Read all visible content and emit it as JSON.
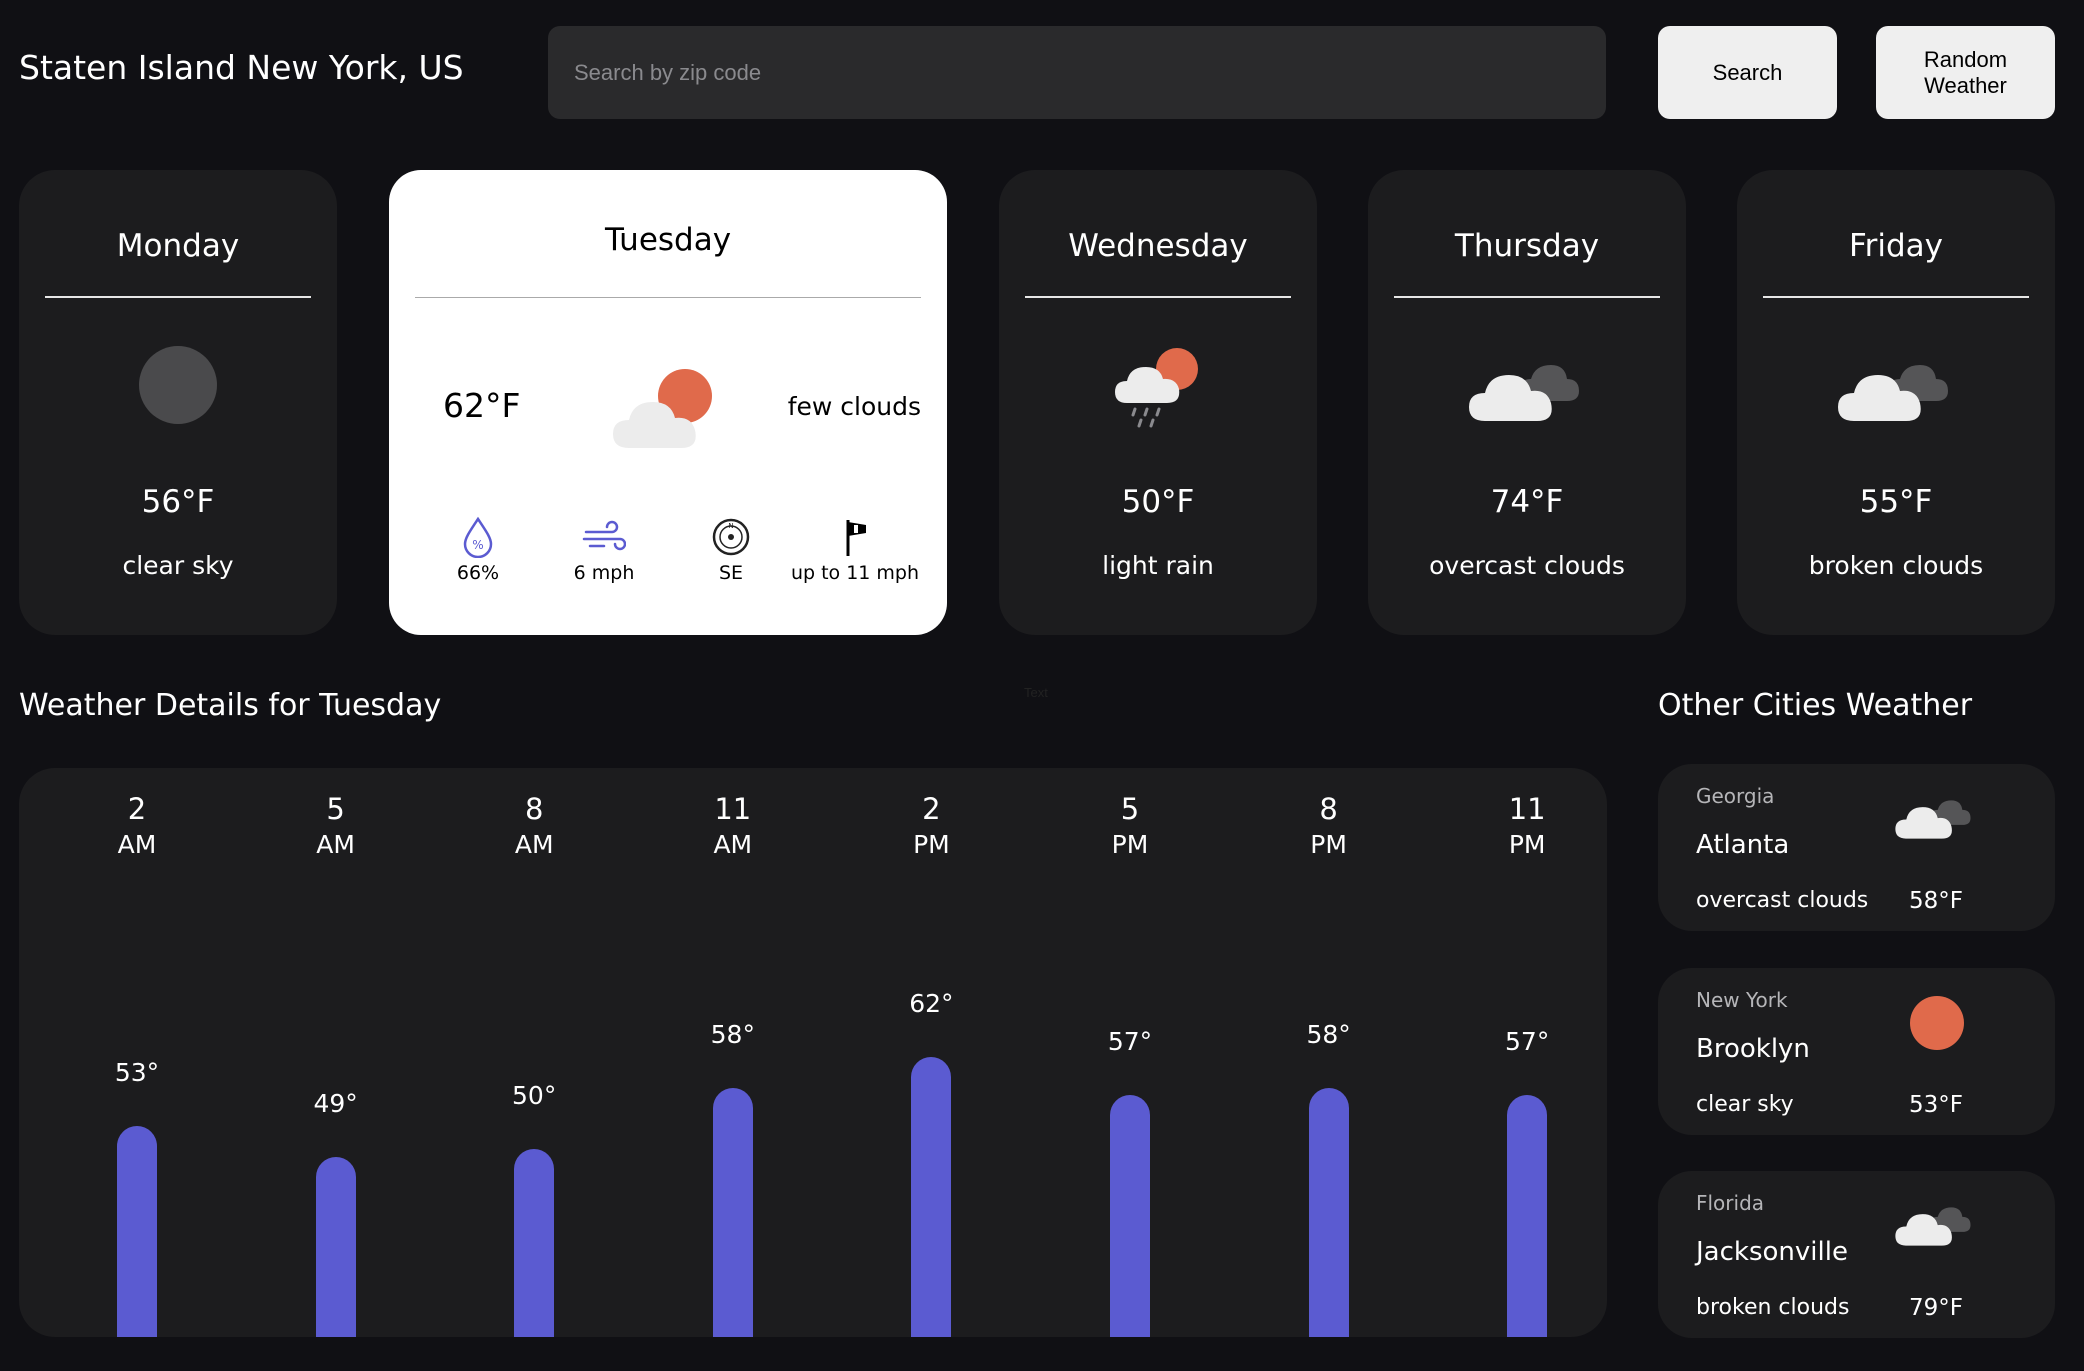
{
  "header": {
    "location": "Staten Island New York, US",
    "search_placeholder": "Search by zip code",
    "search_label": "Search",
    "random_label": "Random\nWeather"
  },
  "days": [
    {
      "name": "Monday",
      "temp": "56°F",
      "desc": "clear sky",
      "icon": "moon-icon"
    },
    {
      "name": "Tuesday",
      "temp": "62°F",
      "desc": "few clouds",
      "icon": "partly-cloudy-icon",
      "humidity": "66%",
      "wind": "6 mph",
      "direction": "SE",
      "gust": "up to 11 mph"
    },
    {
      "name": "Wednesday",
      "temp": "50°F",
      "desc": "light rain",
      "icon": "rain-icon"
    },
    {
      "name": "Thursday",
      "temp": "74°F",
      "desc": "overcast clouds",
      "icon": "overcast-icon"
    },
    {
      "name": "Friday",
      "temp": "55°F",
      "desc": "broken clouds",
      "icon": "broken-clouds-icon"
    }
  ],
  "details_title": "Weather Details for Tuesday",
  "stray_text": "Text",
  "colors": {
    "bar": "#5b5bd1",
    "sun": "#e06a4b",
    "background": "#101014",
    "card": "#1c1c1e"
  },
  "chart_data": {
    "type": "bar",
    "categories": [
      "2 AM",
      "5 AM",
      "8 AM",
      "11 AM",
      "2 PM",
      "5 PM",
      "8 PM",
      "11 PM"
    ],
    "hours": [
      {
        "num": "2",
        "ampm": "AM",
        "label": "53°",
        "value": 53
      },
      {
        "num": "5",
        "ampm": "AM",
        "label": "49°",
        "value": 49
      },
      {
        "num": "8",
        "ampm": "AM",
        "label": "50°",
        "value": 50
      },
      {
        "num": "11",
        "ampm": "AM",
        "label": "58°",
        "value": 58
      },
      {
        "num": "2",
        "ampm": "PM",
        "label": "62°",
        "value": 62
      },
      {
        "num": "5",
        "ampm": "PM",
        "label": "57°",
        "value": 57
      },
      {
        "num": "8",
        "ampm": "PM",
        "label": "58°",
        "value": 58
      },
      {
        "num": "11",
        "ampm": "PM",
        "label": "57°",
        "value": 57
      }
    ]
  },
  "other_cities_title": "Other Cities Weather",
  "cities": [
    {
      "state": "Georgia",
      "name": "Atlanta",
      "desc": "overcast clouds",
      "temp": "58°F",
      "icon": "overcast-icon"
    },
    {
      "state": "New York",
      "name": "Brooklyn",
      "desc": "clear sky",
      "temp": "53°F",
      "icon": "sun-icon"
    },
    {
      "state": "Florida",
      "name": "Jacksonville",
      "desc": "broken clouds",
      "temp": "79°F",
      "icon": "broken-clouds-icon"
    }
  ]
}
